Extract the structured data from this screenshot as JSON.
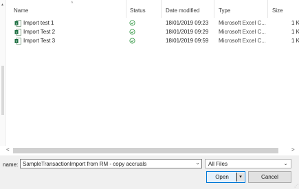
{
  "columns": {
    "name": "Name",
    "status": "Status",
    "date_modified": "Date modified",
    "type": "Type",
    "size": "Size"
  },
  "files": [
    {
      "name": "Import test 1",
      "date": "18/01/2019 09:23",
      "type": "Microsoft Excel C...",
      "size": "1 K",
      "icon": "excel-file-icon",
      "status_icon": "synced-check-icon"
    },
    {
      "name": "Import Test 2",
      "date": "18/01/2019 09:29",
      "type": "Microsoft Excel C...",
      "size": "1 K",
      "icon": "excel-file-icon",
      "status_icon": "synced-check-icon"
    },
    {
      "name": "Import Test 3",
      "date": "18/01/2019 09:59",
      "type": "Microsoft Excel C...",
      "size": "1 K",
      "icon": "excel-file-icon",
      "status_icon": "synced-check-icon"
    }
  ],
  "file_name": {
    "label": "name:",
    "value": "SampleTransactionImport from RM - copy accruals"
  },
  "filter": {
    "selected": "All Files"
  },
  "buttons": {
    "open": "Open",
    "cancel": "Cancel"
  },
  "colors": {
    "excel_green": "#1d6f42",
    "status_green": "#3a9b4a",
    "accent_blue": "#0078d7"
  }
}
